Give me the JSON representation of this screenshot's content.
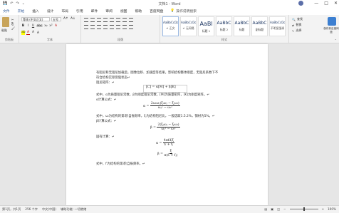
{
  "window": {
    "doc_title": "文档1 - Word",
    "quick_access": [
      "💾",
      "↶",
      "↷",
      "⌄"
    ],
    "user_name": "",
    "controls": [
      "—",
      "□",
      "✕"
    ]
  },
  "tabs": [
    {
      "label": "文件",
      "key": "file"
    },
    {
      "label": "开始",
      "key": "home"
    },
    {
      "label": "插入",
      "key": "insert"
    },
    {
      "label": "设计",
      "key": "design"
    },
    {
      "label": "布局",
      "key": "layout"
    },
    {
      "label": "引用",
      "key": "references"
    },
    {
      "label": "邮件",
      "key": "mailings"
    },
    {
      "label": "审阅",
      "key": "review"
    },
    {
      "label": "视图",
      "key": "view"
    },
    {
      "label": "帮助",
      "key": "help"
    },
    {
      "label": "百度网盘",
      "key": "baidu"
    }
  ],
  "tell_me": "操作说明搜索",
  "ribbon": {
    "paste_label": "粘贴",
    "font_name": "等线 (中文正文)",
    "font_size": "五号",
    "clipboard_label": "剪贴板",
    "font_label": "字体",
    "paragraph_label": "段落",
    "styles_label": "样式",
    "format_buttons": [
      "B",
      "I",
      "U",
      "abc",
      "x₂",
      "x²",
      "A"
    ],
    "styles": [
      {
        "sample": "AaBbCcDc",
        "name": "↵ 正文",
        "size": "4.2px"
      },
      {
        "sample": "AaBbCcDc",
        "name": "↵ 无间隔",
        "size": "4.2px"
      },
      {
        "sample": "AaBl",
        "name": "标题 1",
        "size": "8px"
      },
      {
        "sample": "AaBbC",
        "name": "标题 2",
        "size": "6px"
      },
      {
        "sample": "AaBbC",
        "name": "标题",
        "size": "6px"
      },
      {
        "sample": "AaBbC",
        "name": "副标题",
        "size": "6px"
      },
      {
        "sample": "AaBbCcDc",
        "name": "不明显强调",
        "size": "4.2px"
      }
    ],
    "edit_items": [
      "查找",
      "替换",
      "选择"
    ],
    "cloud_label": "保存到百度网盘"
  },
  "document": {
    "lines": [
      "有阻尼和无阻尼加载后，图像位移、加速度等结果。影响结构整体刚度，无阻尼系数下不",
      "符合结构实际受阻状态↵",
      "阻尼矩阵：↵",
      "式中，α为质量阻尼常数，β为刚度阻尼常数，[M]为质量矩阵，[K]为刚度矩阵。↵",
      "α计算公式：↵",
      "式中，ωᵢ为结构的第i阶自振频率，ξᵢ为结构阻尼比，一般选取1.5.2%，钢材为5%。↵",
      "β计算公式：↵",
      "固有计算：↵",
      "式中，fᵢ为结构的第i阶自振频率。↵"
    ],
    "formulas": {
      "damping_matrix": "[C] = α[M] + β[K]",
      "alpha_lhs": "α =",
      "alpha_num": "2ωᵢωⱼ(ξᵢωⱼ − ξⱼωᵢ)",
      "alpha_den": "ωⱼ² − ωᵢ²",
      "beta_lhs": "β =",
      "beta_num": "2(ξⱼωⱼ − ξᵢωᵢ)",
      "beta_den": "ωⱼ² − ωᵢ²",
      "omega_lhs": "α =",
      "omega_num": "4πfᵢfⱼξ",
      "omega_den": "fᵢ + fⱼ",
      "omega2_lhs": "β =",
      "omega2_num": "ξ",
      "omega2_den": "π(fᵢ + fⱼ)"
    }
  },
  "status": {
    "page": "第1页，共1页",
    "words": "256 个字",
    "lang": "中文(中国)",
    "accessibility": "辅助功能: 一切就绪",
    "zoom": "100%",
    "zoom_fraction": 0.5
  }
}
